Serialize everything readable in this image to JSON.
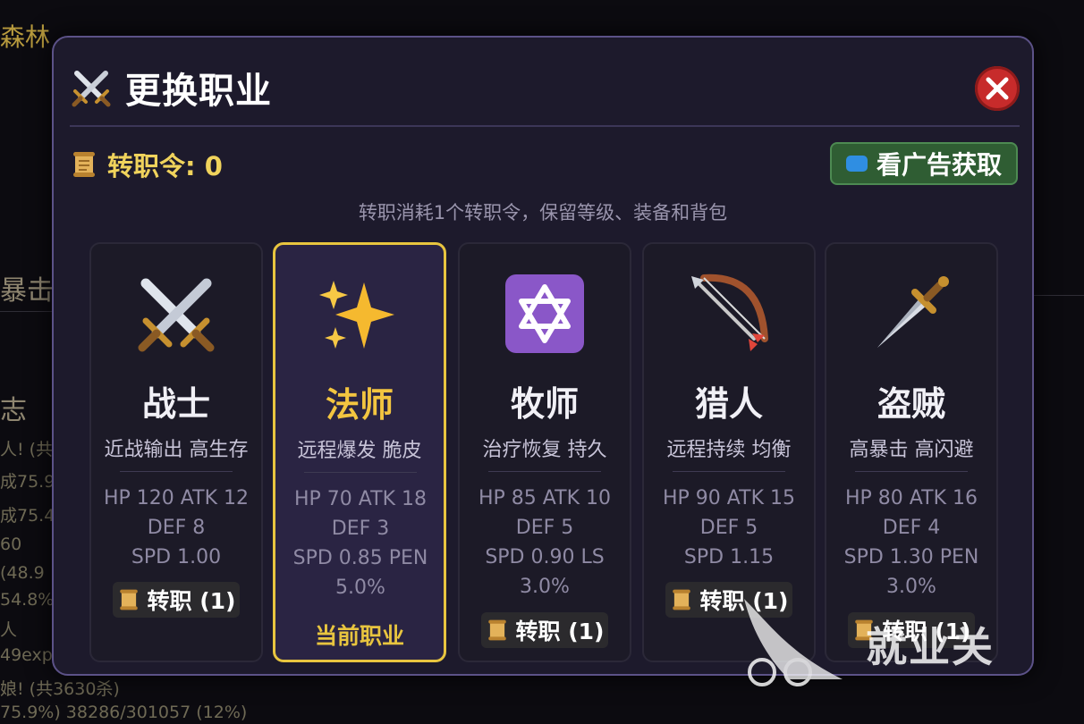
{
  "background": {
    "area_name_fragment": "森林",
    "section_heading_fragment": "暴击",
    "log_heading_fragment": "志",
    "log_lines": [
      "人! (共",
      "成75.9",
      "成75.4",
      "60",
      "(48.9",
      "54.8%",
      "人",
      "49exp",
      "娘! (共3630杀)",
      "75.9%)  38286/301057 (12%)"
    ]
  },
  "dialog": {
    "title": "更换职业",
    "title_icon": "crossed-swords-icon",
    "close_icon": "close-icon",
    "token_label": "转职令: 0",
    "ad_button_label": "看广告获取",
    "hint": "转职消耗1个转职令，保留等级、装备和背包",
    "current_label": "当前职业",
    "colors": {
      "accent_gold": "#e8c53f",
      "ad_green": "#2f5d33",
      "close_red": "#c72b2b",
      "panel": "#1d1a2c"
    }
  },
  "classes": [
    {
      "name": "战士",
      "icon": "crossed-swords-icon",
      "desc": "近战输出 高生存",
      "stats": [
        "HP 120 ATK 12",
        "DEF 8",
        "SPD 1.00"
      ],
      "button": "转职 (1)",
      "current": false
    },
    {
      "name": "法师",
      "icon": "sparkles-icon",
      "desc": "远程爆发 脆皮",
      "stats": [
        "HP 70 ATK 18",
        "DEF 3",
        "SPD 0.85 PEN",
        "5.0%"
      ],
      "button": "",
      "current": true
    },
    {
      "name": "牧师",
      "icon": "star-of-david-icon",
      "desc": "治疗恢复 持久",
      "stats": [
        "HP 85 ATK 10",
        "DEF 5",
        "SPD 0.90 LS",
        "3.0%"
      ],
      "button": "转职 (1)",
      "current": false
    },
    {
      "name": "猎人",
      "icon": "bow-and-arrow-icon",
      "desc": "远程持续 均衡",
      "stats": [
        "HP 90 ATK 15",
        "DEF 5",
        "SPD 1.15"
      ],
      "button": "转职 (1)",
      "current": false
    },
    {
      "name": "盗贼",
      "icon": "dagger-icon",
      "desc": "高暴击 高闪避",
      "stats": [
        "HP 80 ATK 16",
        "DEF 4",
        "SPD 1.30 PEN",
        "3.0%"
      ],
      "button": "转职 (1)",
      "current": false
    }
  ],
  "watermark": {
    "text": "就业关"
  }
}
